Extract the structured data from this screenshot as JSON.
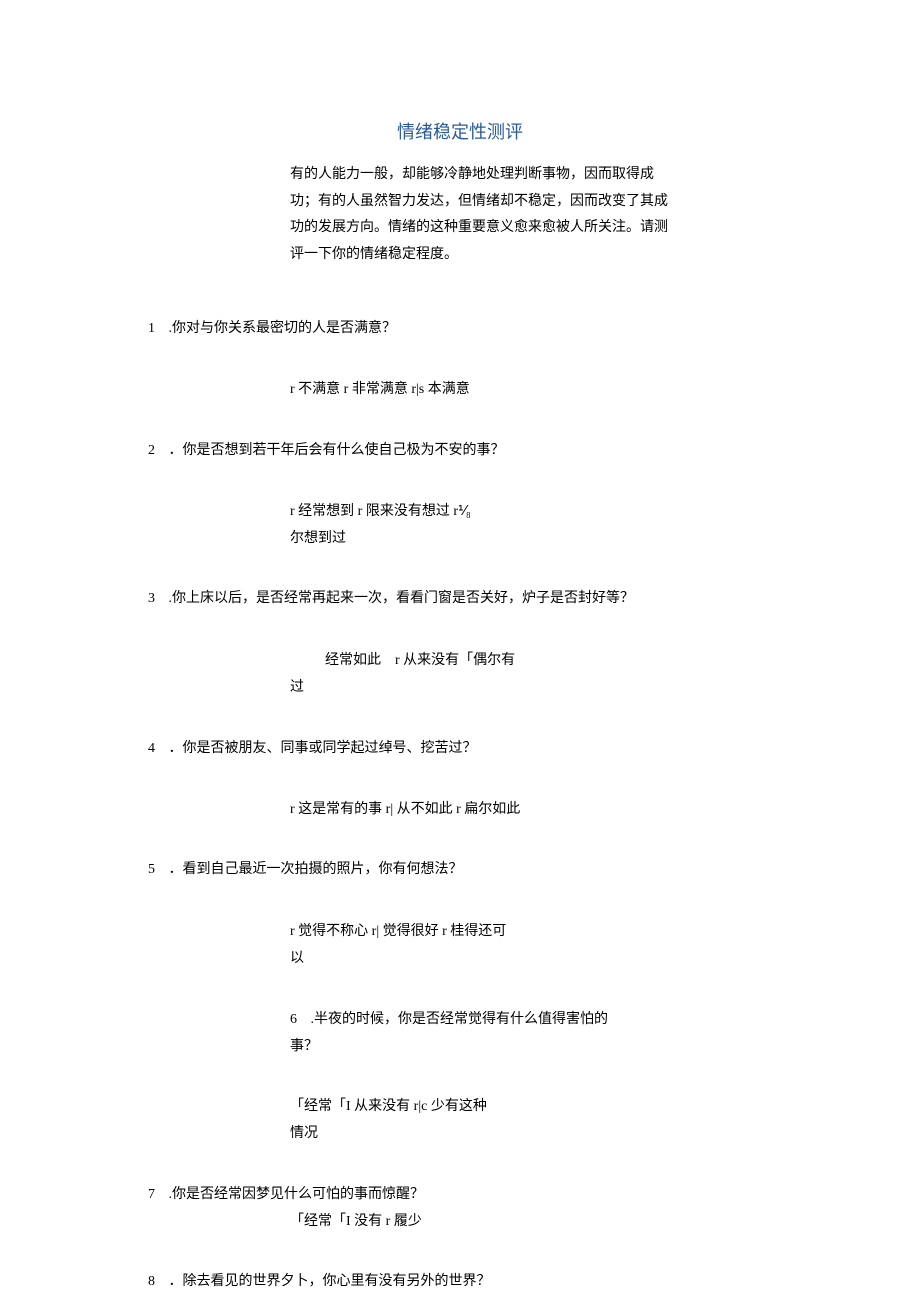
{
  "title": "情绪稳定性测评",
  "intro": "有的人能力一般，却能够冷静地处理判断事物，因而取得成功；有的人虽然智力发达，但情绪却不稳定，因而改变了其成功的发展方向。情绪的这种重要意义愈来愈被人所关注。请测评一下你的情绪稳定程度。",
  "q1": {
    "num": "1",
    "text": ".你对与你关系最密切的人是否满意？",
    "options": "r 不满意 r 非常满意 r|s 本满意"
  },
  "q2": {
    "num": "2",
    "text": "．你是否想到若干年后会有什么使自己极为不安的事？",
    "options_line1": "r 经常想到 r 限来没有想过 r⅟₈",
    "options_line2": "尔想到过"
  },
  "q3": {
    "num": "3",
    "text": ".你上床以后，是否经常再起来一次，看看门窗是否关好，炉子是否封好等？",
    "options_line1": "经常如此　r 从来没有「偶尔有",
    "options_line2": "过"
  },
  "q4": {
    "num": "4",
    "text": "．你是否被朋友、同事或同学起过绰号、挖苦过？",
    "options": "r 这是常有的事 r| 从不如此 r 扁尔如此"
  },
  "q5": {
    "num": "5",
    "text": "．看到自己最近一次拍摄的照片，你有何想法？",
    "options_line1": "r 觉得不称心 r| 觉得很好 r 桂得还可",
    "options_line2": "以"
  },
  "q6": {
    "num": "6",
    "text": ".半夜的时候，你是否经常觉得有什么值得害怕的事？",
    "options_line1": "「经常「I 从来没有 r|c 少有这种",
    "options_line2": "情况"
  },
  "q7": {
    "num": "7",
    "text": ".你是否经常因梦见什么可怕的事而惊醒？",
    "options": "「经常「I 没有 r 履少"
  },
  "q8": {
    "num": "8",
    "text": "．除去看见的世界夕卜，你心里有没有另外的世界？"
  }
}
